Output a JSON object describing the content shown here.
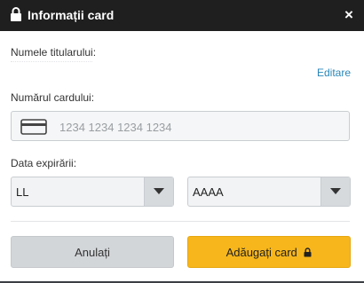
{
  "dialog": {
    "title": "Informații card",
    "close_label": "×"
  },
  "form": {
    "holder_label": "Numele titularului:",
    "edit_link": "Editare",
    "card_number_label": "Numărul cardului:",
    "card_number_placeholder": "1234 1234 1234 1234",
    "card_number_value": "",
    "expiry_label": "Data expirării:",
    "month_select": {
      "value": "LL"
    },
    "year_select": {
      "value": "AAAA"
    }
  },
  "buttons": {
    "cancel_label": "Anulați",
    "add_card_label": "Adăugați card"
  },
  "icons": {
    "header_lock": "lock-icon",
    "close": "close-icon",
    "card": "credit-card-icon",
    "dropdown": "chevron-down-icon",
    "button_lock": "lock-icon"
  },
  "colors": {
    "header_bg": "#1f1f1f",
    "link": "#2a86b8",
    "primary_button": "#f7b61b",
    "secondary_button": "#d3d6d9"
  }
}
